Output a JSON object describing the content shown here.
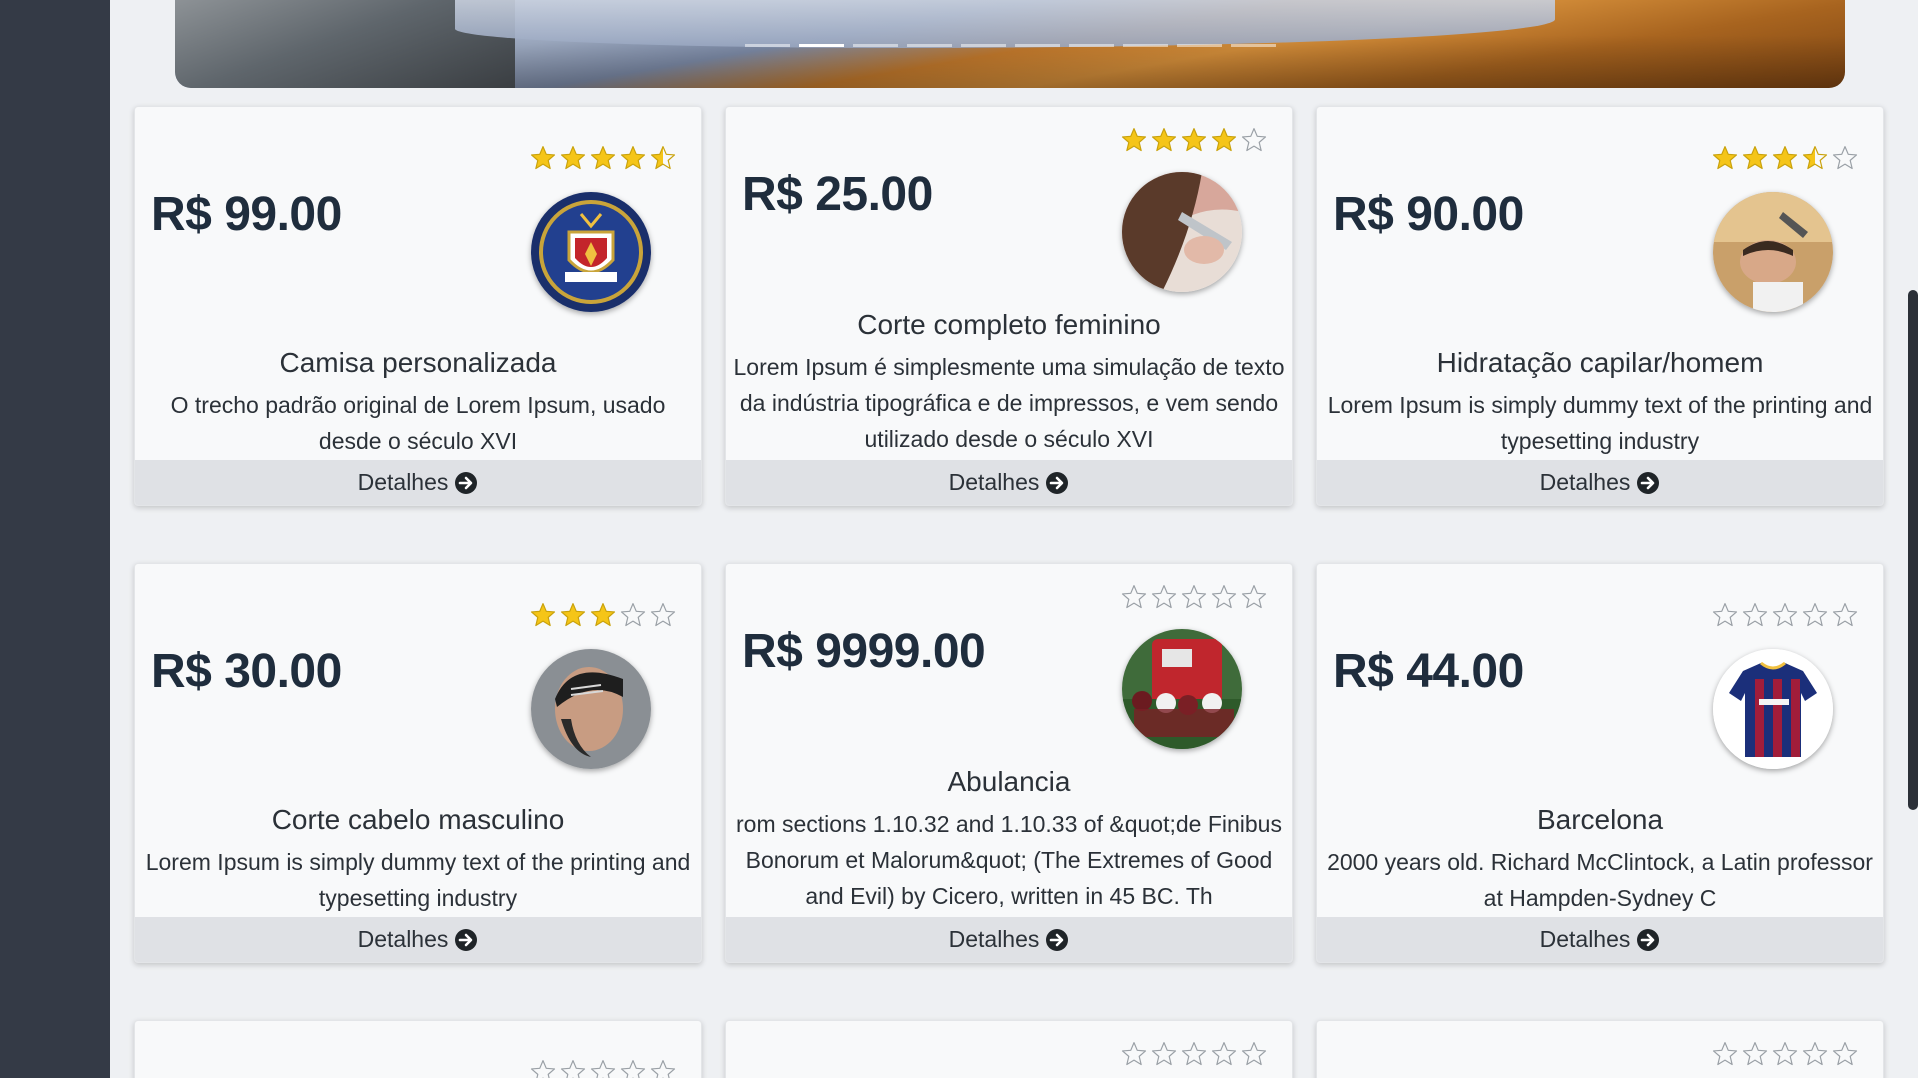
{
  "banner": {
    "indicator_count": 10,
    "active_indicator": 1
  },
  "cards": [
    {
      "price": "R$ 99.00",
      "rating": 4.5,
      "title": "Camisa personalizada",
      "description": "O trecho padrão original de Lorem Ipsum, usado desde o século XVI",
      "button_label": "Detalhes",
      "image_icon": "crest-shirt-image"
    },
    {
      "price": "R$ 25.00",
      "rating": 4,
      "title": "Corte completo feminino",
      "description": "Lorem Ipsum é simplesmente uma simulação de texto da indústria tipográfica e de impressos, e vem sendo utilizado desde o século XVI",
      "button_label": "Detalhes",
      "image_icon": "hair-cut-woman-image"
    },
    {
      "price": "R$ 90.00",
      "rating": 3.5,
      "title": "Hidratação capilar/homem",
      "description": "Lorem Ipsum is simply dummy text of the printing and typesetting industry",
      "button_label": "Detalhes",
      "image_icon": "hair-wash-man-image"
    },
    {
      "price": "R$ 30.00",
      "rating": 3,
      "title": "Corte cabelo masculino",
      "description": "Lorem Ipsum is simply dummy text of the printing and typesetting industry",
      "button_label": "Detalhes",
      "image_icon": "man-haircut-image"
    },
    {
      "price": "R$ 9999.00",
      "rating": 0,
      "title": "Abulancia",
      "description": "rom sections 1.10.32 and 1.10.33 of &quot;de Finibus Bonorum et Malorum&quot; (The Extremes of Good and Evil) by Cicero, written in 45 BC. Th",
      "button_label": "Detalhes",
      "image_icon": "ambulance-image"
    },
    {
      "price": "R$ 44.00",
      "rating": 0,
      "title": "Barcelona",
      "description": "2000 years old. Richard McClintock, a Latin professor at Hampden-Sydney C",
      "button_label": "Detalhes",
      "image_icon": "barcelona-jersey-image"
    },
    {
      "rating": 0
    },
    {
      "rating": 0
    },
    {
      "rating": 0
    }
  ],
  "colors": {
    "sidebar": "#343a46",
    "star_filled": "#f5c518",
    "star_empty_stroke": "#9aa0a6",
    "price": "#1f2d3d",
    "footer_bg": "#dfe1e5"
  }
}
